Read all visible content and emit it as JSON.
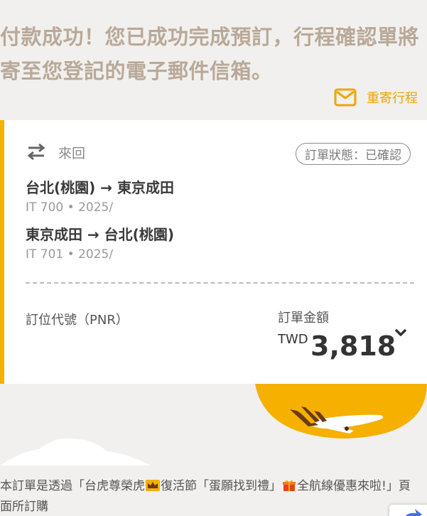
{
  "header": {
    "headline": "付款成功！您已成功完成預訂，行程確認單將寄至您登記的電子郵件信箱。",
    "resend_icon": "mail-icon",
    "resend_label": "重寄行程"
  },
  "booking": {
    "trip_icon": "swap-arrows-icon",
    "trip_type": "來回",
    "status": "訂單狀態：已確認",
    "flights": [
      {
        "route": "台北(桃園) → 東京成田",
        "meta": "IT 700 • 2025/"
      },
      {
        "route": "東京成田 → 台北(桃園)",
        "meta": "IT 701 • 2025/"
      }
    ],
    "pnr_label": "訂位代號（PNR）",
    "amount_label": "訂單金額",
    "currency": "TWD",
    "amount": "3,818",
    "expand_icon": "chevron-down-icon"
  },
  "promo": {
    "text_before": "本訂單是透過「台虎尊榮虎",
    "crown_icon": "crown-icon",
    "text_middle": "復活節「蛋願找到禮」",
    "gift_icon": "gift-icon",
    "text_after": "全航線優惠來啦!」頁面所訂購"
  },
  "colors": {
    "accent": "#f5b000",
    "accent_text": "#f0a500",
    "headline": "#b9a999",
    "background": "#f1f0ee"
  }
}
